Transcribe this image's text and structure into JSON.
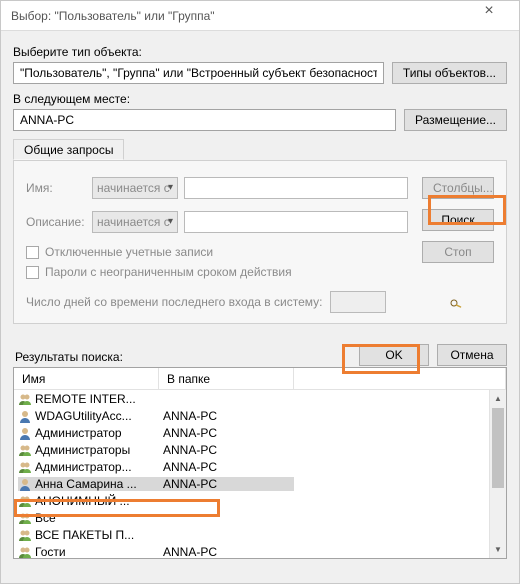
{
  "window_title": "Выбор: \"Пользователь\" или \"Группа\"",
  "labels": {
    "select_object_type": "Выберите тип объекта:",
    "location": "В следующем месте:",
    "results": "Результаты поиска:"
  },
  "fields": {
    "object_types_value": "\"Пользователь\", \"Группа\" или \"Встроенный субъект безопасности\"",
    "location_value": "ANNA-PC"
  },
  "buttons": {
    "object_types": "Типы объектов...",
    "locations": "Размещение...",
    "columns": "Столбцы...",
    "search": "Поиск",
    "stop": "Стоп",
    "ok": "OK",
    "cancel": "Отмена"
  },
  "tabs": {
    "common_queries": "Общие запросы"
  },
  "query": {
    "name_label": "Имя:",
    "name_mode": "начинается с",
    "desc_label": "Описание:",
    "desc_mode": "начинается с",
    "chk_disabled": "Отключенные учетные записи",
    "chk_pwd": "Пароли с неограниченным сроком действия",
    "days_label": "Число дней со времени последнего входа в систему:"
  },
  "list": {
    "col_name": "Имя",
    "col_folder": "В папке",
    "rows": [
      {
        "icon": "group",
        "name": "REMOTE INTER...",
        "folder": ""
      },
      {
        "icon": "user",
        "name": "WDAGUtilityAcc...",
        "folder": "ANNA-PC"
      },
      {
        "icon": "user",
        "name": "Администратор",
        "folder": "ANNA-PC"
      },
      {
        "icon": "group",
        "name": "Администраторы",
        "folder": "ANNA-PC"
      },
      {
        "icon": "group",
        "name": "Администратор...",
        "folder": "ANNA-PC"
      },
      {
        "icon": "user",
        "name": "Анна Самарина ...",
        "folder": "ANNA-PC",
        "selected": true
      },
      {
        "icon": "group",
        "name": "АНОНИМНЫЙ ...",
        "folder": ""
      },
      {
        "icon": "group",
        "name": "Все",
        "folder": ""
      },
      {
        "icon": "group",
        "name": "ВСЕ ПАКЕТЫ П...",
        "folder": ""
      },
      {
        "icon": "group",
        "name": "Гости",
        "folder": "ANNA-PC"
      }
    ]
  }
}
